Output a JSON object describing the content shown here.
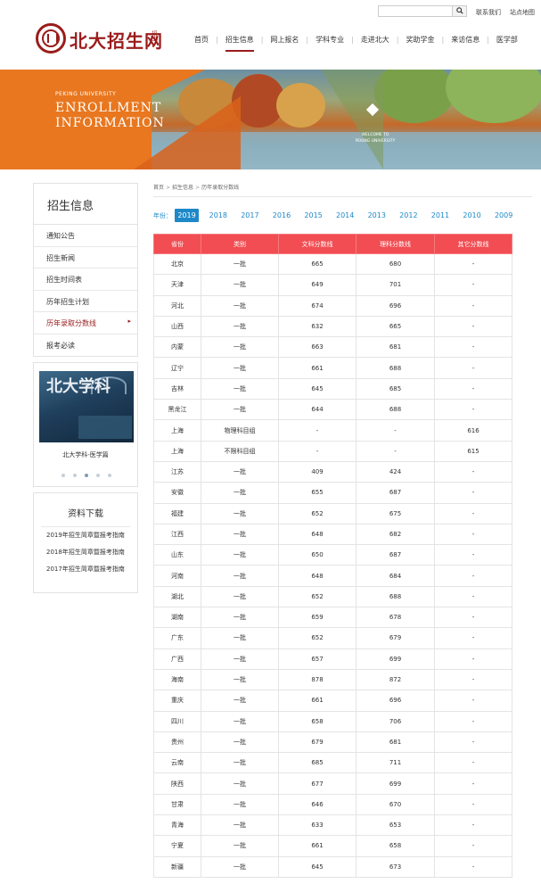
{
  "topbar": {
    "search_placeholder": "",
    "contact_label": "联系我们",
    "sitemap_label": "站点地图"
  },
  "header": {
    "logo_text": "北大招生网",
    "logo_sub": "招生",
    "nav": [
      "首页",
      "招生信息",
      "网上报名",
      "学科专业",
      "走进北大",
      "奖助学金",
      "来访信息",
      "医学部"
    ]
  },
  "banner": {
    "pku": "PEKING UNIVERSITY",
    "title_line1": "ENROLLMENT",
    "title_line2": "INFORMATION",
    "welcome": "WELCOME TO PEKING UNIVERSITY"
  },
  "sidebar": {
    "title": "招生信息",
    "items": [
      "通知公告",
      "招生新闻",
      "招生时间表",
      "历年招生计划",
      "历年录取分数线",
      "报考必读"
    ],
    "active_arrow": "▸"
  },
  "promo": {
    "image_text": "北大学科",
    "caption": "北大学科-医学篇"
  },
  "downloads": {
    "title": "资料下载",
    "items": [
      "2019年招生简章暨报考指南",
      "2018年招生简章暨报考指南",
      "2017年招生简章暨报考指南"
    ]
  },
  "breadcrumb": [
    "首页",
    "招生信息",
    "历年录取分数线"
  ],
  "years": {
    "label": "年份：",
    "list": [
      "2019",
      "2018",
      "2017",
      "2016",
      "2015",
      "2014",
      "2013",
      "2012",
      "2011",
      "2010",
      "2009"
    ]
  },
  "table": {
    "headers": [
      "省份",
      "类别",
      "文科分数线",
      "理科分数线",
      "其它分数线"
    ],
    "rows": [
      [
        "北京",
        "一批",
        "665",
        "680",
        "-"
      ],
      [
        "天津",
        "一批",
        "649",
        "701",
        "-"
      ],
      [
        "河北",
        "一批",
        "674",
        "696",
        "-"
      ],
      [
        "山西",
        "一批",
        "632",
        "665",
        "-"
      ],
      [
        "内蒙",
        "一批",
        "663",
        "681",
        "-"
      ],
      [
        "辽宁",
        "一批",
        "661",
        "688",
        "-"
      ],
      [
        "吉林",
        "一批",
        "645",
        "685",
        "-"
      ],
      [
        "黑龙江",
        "一批",
        "644",
        "688",
        "-"
      ],
      [
        "上海",
        "物理科目组",
        "-",
        "-",
        "616"
      ],
      [
        "上海",
        "不限科目组",
        "-",
        "-",
        "615"
      ],
      [
        "江苏",
        "一批",
        "409",
        "424",
        "-"
      ],
      [
        "安徽",
        "一批",
        "655",
        "687",
        "-"
      ],
      [
        "福建",
        "一批",
        "652",
        "675",
        "-"
      ],
      [
        "江西",
        "一批",
        "648",
        "682",
        "-"
      ],
      [
        "山东",
        "一批",
        "650",
        "687",
        "-"
      ],
      [
        "河南",
        "一批",
        "648",
        "684",
        "-"
      ],
      [
        "湖北",
        "一批",
        "652",
        "688",
        "-"
      ],
      [
        "湖南",
        "一批",
        "659",
        "678",
        "-"
      ],
      [
        "广东",
        "一批",
        "652",
        "679",
        "-"
      ],
      [
        "广西",
        "一批",
        "657",
        "699",
        "-"
      ],
      [
        "海南",
        "一批",
        "878",
        "872",
        "-"
      ],
      [
        "重庆",
        "一批",
        "661",
        "696",
        "-"
      ],
      [
        "四川",
        "一批",
        "658",
        "706",
        "-"
      ],
      [
        "贵州",
        "一批",
        "679",
        "681",
        "-"
      ],
      [
        "云南",
        "一批",
        "685",
        "711",
        "-"
      ],
      [
        "陕西",
        "一批",
        "677",
        "699",
        "-"
      ],
      [
        "甘肃",
        "一批",
        "646",
        "670",
        "-"
      ],
      [
        "青海",
        "一批",
        "633",
        "653",
        "-"
      ],
      [
        "宁夏",
        "一批",
        "661",
        "658",
        "-"
      ],
      [
        "新疆",
        "一批",
        "645",
        "673",
        "-"
      ]
    ]
  },
  "colors": {
    "brand_red": "#9b1c1c",
    "table_header": "#f14d52",
    "year_blue": "#1e88c8",
    "banner_orange": "#e8771f"
  }
}
